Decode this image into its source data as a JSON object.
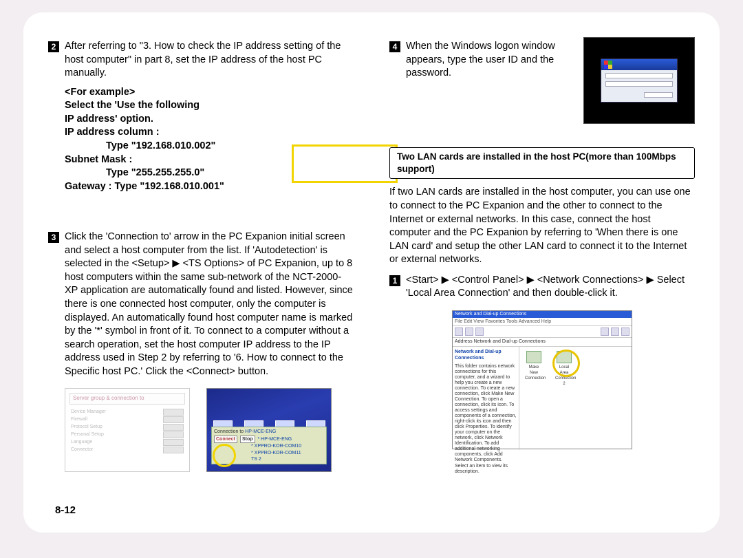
{
  "left": {
    "step2": {
      "num": "2",
      "text": "After referring to \"3. How to check the IP address setting of the host computer\" in part 8, set the IP address of the host PC manually."
    },
    "example": {
      "hdr": "<For example>",
      "l1": "Select the 'Use the following",
      "l2": "IP address' option.",
      "l3": "IP address column :",
      "l3s": "Type \"192.168.010.002\"",
      "l4": "Subnet Mask :",
      "l4s": "Type \"255.255.255.0\"",
      "l5": "Gateway : Type \"192.168.010.001\""
    },
    "step3": {
      "num": "3",
      "text": "Click the 'Connection to' arrow in the PC Expanion initial screen and select a host computer from the list. If 'Autodetection' is selected in the <Setup> ▶ <TS Options> of PC Expanion, up to 8 host computers within the same sub-network of the NCT-2000-XP application are automatically found and listed. However, since there is one connected host computer, only the computer is displayed. An automatically found host computer name is marked by the '*' symbol in front of it. To connect to a computer without a search operation, set the host computer IP address to the IP address used in Step 2 by referring to '6. How to connect to the Specific host PC.' Click the <Connect> button."
    },
    "figa": {
      "tab": "Server group & connection to",
      "rows": [
        "Device Manager",
        "Firewall",
        "Protocol Setup",
        "Personal Setup",
        "Language",
        "Connector"
      ]
    },
    "figb": {
      "connlabel": "Connection to",
      "connect": "Connect",
      "stop": "Stop",
      "hosts": [
        "HP-MCE-ENG",
        "* HP-MCE-ENG",
        "* XPPRO-KOR-COM10",
        "* XPPRO-KOR-COM11",
        "TS 2"
      ]
    }
  },
  "right": {
    "step4": {
      "num": "4",
      "text": "When the Windows logon window appears, type the user ID and the password."
    },
    "callout": "Two LAN cards are installed in the host PC(more than 100Mbps support)",
    "para": "If two LAN cards are installed in the host computer, you can use one to connect to the PC Expanion and the other to connect to the Internet or external networks. In this case, connect the host computer and the PC Expanion by referring to 'When there is one LAN card' and setup the other LAN card to connect it to the Internet or external networks.",
    "step1": {
      "num": "1",
      "text": "<Start> ▶ <Control Panel> ▶ <Network Connections> ▶ Select 'Local Area Connection' and then double-click it."
    },
    "netfig": {
      "title": "Network and Dial-up Connections",
      "menu": "File  Edit  View  Favorites  Tools  Advanced  Help",
      "addr": "Address  Network and Dial-up Connections",
      "sideHdr": "Network and Dial-up Connections",
      "sideTxt": "This folder contains network connections for this computer, and a wizard to help you create a new connection. To create a new connection, click Make New Connection. To open a connection, click its icon. To access settings and components of a connection, right-click its icon and then click Properties. To identify your computer on the network, click Network Identification. To add additional networking components, click Add Network Components. Select an item to view its description.",
      "ic1": "Make New Connection",
      "ic2": "Local Area Connection 2"
    }
  },
  "pagenum": "8-12"
}
